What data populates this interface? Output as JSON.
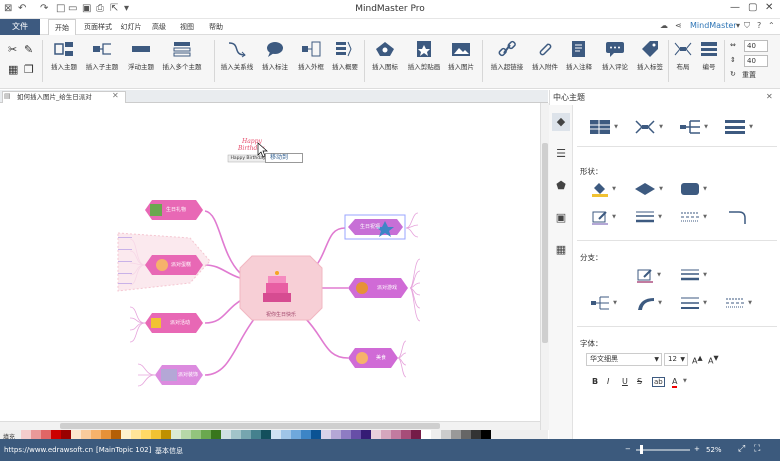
{
  "app": {
    "title": "MindMaster Pro",
    "brand": "MindMaster",
    "brand_color": "#2e75b6"
  },
  "menu": {
    "file": "文件",
    "items": [
      "开始",
      "页面样式",
      "幻灯片",
      "高级",
      "视图",
      "帮助"
    ],
    "active_index": 0
  },
  "ribbon": {
    "buttons": [
      {
        "label": "插入主题",
        "icon": "topic-icon"
      },
      {
        "label": "插入子主题",
        "icon": "subtopic-icon"
      },
      {
        "label": "浮动主题",
        "icon": "floating-topic-icon"
      },
      {
        "label": "插入多个主题",
        "icon": "multi-topic-icon"
      },
      {
        "label": "插入关系线",
        "icon": "relationship-icon"
      },
      {
        "label": "插入标注",
        "icon": "callout-icon"
      },
      {
        "label": "插入外框",
        "icon": "boundary-icon"
      },
      {
        "label": "插入概要",
        "icon": "summary-icon"
      },
      {
        "label": "插入图标",
        "icon": "icon-insert-icon"
      },
      {
        "label": "插入剪贴画",
        "icon": "clipart-icon"
      },
      {
        "label": "插入图片",
        "icon": "picture-icon"
      },
      {
        "label": "插入超链接",
        "icon": "hyperlink-icon"
      },
      {
        "label": "插入附件",
        "icon": "attachment-icon"
      },
      {
        "label": "插入注释",
        "icon": "note-icon"
      },
      {
        "label": "插入评论",
        "icon": "comment-icon"
      },
      {
        "label": "插入标签",
        "icon": "tag-icon"
      },
      {
        "label": "布局",
        "icon": "layout-icon"
      },
      {
        "label": "编号",
        "icon": "numbering-icon"
      }
    ],
    "spin1": "40",
    "spin2": "40",
    "reset": "重置"
  },
  "document": {
    "tab": "如何插入图片_给生日派对"
  },
  "canvas": {
    "central": "祝你生日快乐",
    "floating_caption": "Happy Birthday",
    "tooltip": "移动到",
    "topics": [
      {
        "label": "生日礼物"
      },
      {
        "label": "派对蛋糕"
      },
      {
        "label": "派对活动"
      },
      {
        "label": "生日祝福"
      },
      {
        "label": "派对游戏"
      },
      {
        "label": "派对装饰"
      },
      {
        "label": "美食"
      }
    ]
  },
  "panel": {
    "title": "中心主题",
    "shape_label": "形状：",
    "branch_label": "分支：",
    "font_label": "字体：",
    "font_name": "华文细黑",
    "font_size": "12",
    "format_buttons": [
      "B",
      "I",
      "U",
      "S",
      "ab",
      "A"
    ]
  },
  "status": {
    "url": "https://www.edrawsoft.cn",
    "topic": "[MainTopic 102]",
    "info": "基本信息",
    "zoom": "52%",
    "fill_label": "填充"
  },
  "palette_colors": [
    "#f4cccc",
    "#ea9999",
    "#e06666",
    "#cc0000",
    "#990000",
    "#fce5cd",
    "#f9cb9c",
    "#f6b26b",
    "#e69138",
    "#b45f06",
    "#fff2cc",
    "#ffe599",
    "#ffd966",
    "#f1c232",
    "#bf9000",
    "#d9ead3",
    "#b6d7a8",
    "#93c47d",
    "#6aa84f",
    "#38761d",
    "#d0e0e3",
    "#a2c4c9",
    "#76a5af",
    "#45818e",
    "#134f5c",
    "#cfe2f3",
    "#9fc5e8",
    "#6fa8dc",
    "#3d85c6",
    "#0b5394",
    "#d9d2e9",
    "#b4a7d6",
    "#8e7cc3",
    "#674ea7",
    "#351c75",
    "#ead1dc",
    "#d5a6bd",
    "#c27ba0",
    "#a64d79",
    "#741b47",
    "#ffffff",
    "#eeeeee",
    "#cccccc",
    "#999999",
    "#666666",
    "#333333",
    "#000000"
  ]
}
